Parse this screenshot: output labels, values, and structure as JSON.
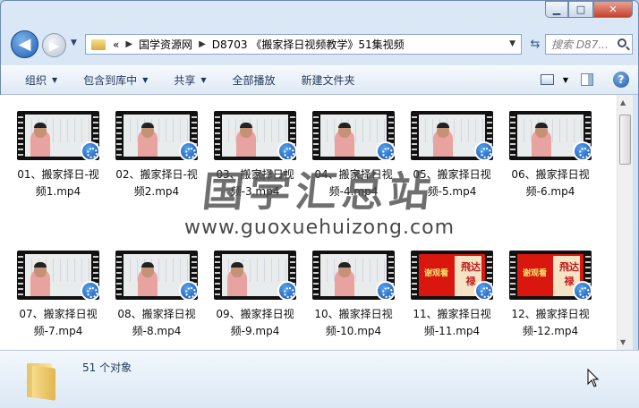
{
  "window": {
    "caption": {
      "minimize": "▁",
      "maximize": "□",
      "close": "✕"
    }
  },
  "nav": {
    "back": "◀",
    "forward": "▶",
    "path_prefix": "«",
    "crumbs": [
      "国学资源网",
      "D8703 《搬家择日视频教学》51集视频"
    ],
    "search_placeholder": "搜索 D87..."
  },
  "toolbar": {
    "organize": "组织",
    "include_library": "包含到库中",
    "share": "共享",
    "play_all": "全部播放",
    "new_folder": "新建文件夹"
  },
  "files": [
    {
      "name": "01、搬家择日-视频1.mp4",
      "line1": "01、搬家择日-视",
      "line2": "频1.mp4"
    },
    {
      "name": "02、搬家择日-视频2.mp4",
      "line1": "02、搬家择日-视",
      "line2": "频2.mp4"
    },
    {
      "name": "03、搬家择日视频-3.mp4",
      "line1": "03、搬家择日视",
      "line2": "频-3.mp4"
    },
    {
      "name": "04、搬家择日视频-4.mp4",
      "line1": "04、搬家择日视",
      "line2": "频-4.mp4"
    },
    {
      "name": "05、搬家择日视频-5.mp4",
      "line1": "05、搬家择日视",
      "line2": "频-5.mp4"
    },
    {
      "name": "06、搬家择日视频-6.mp4",
      "line1": "06、搬家择日视",
      "line2": "频-6.mp4"
    },
    {
      "name": "07、搬家择日视频-7.mp4",
      "line1": "07、搬家择日视",
      "line2": "频-7.mp4"
    },
    {
      "name": "08、搬家择日视频-8.mp4",
      "line1": "08、搬家择日视",
      "line2": "频-8.mp4"
    },
    {
      "name": "09、搬家择日视频-9.mp4",
      "line1": "09、搬家择日视",
      "line2": "频-9.mp4"
    },
    {
      "name": "10、搬家择日视频-10.mp4",
      "line1": "10、搬家择日视",
      "line2": "频-10.mp4"
    },
    {
      "name": "11、搬家择日视频-11.mp4",
      "line1": "11、搬家择日视",
      "line2": "频-11.mp4"
    },
    {
      "name": "12、搬家择日视频-12.mp4",
      "line1": "12、搬家择日视",
      "line2": "频-12.mp4"
    }
  ],
  "thumb_text": {
    "red_caption": "谢观看",
    "red_scrawl": "飛达禄"
  },
  "watermark": {
    "title": "国学汇总站",
    "url": "www.guoxuehuizong.com"
  },
  "details": {
    "object_count": "51 个对象"
  },
  "colors": {
    "accent": "#1d5fb4",
    "window_frame": "#c9dcf1",
    "red_frame": "#d9170f"
  }
}
